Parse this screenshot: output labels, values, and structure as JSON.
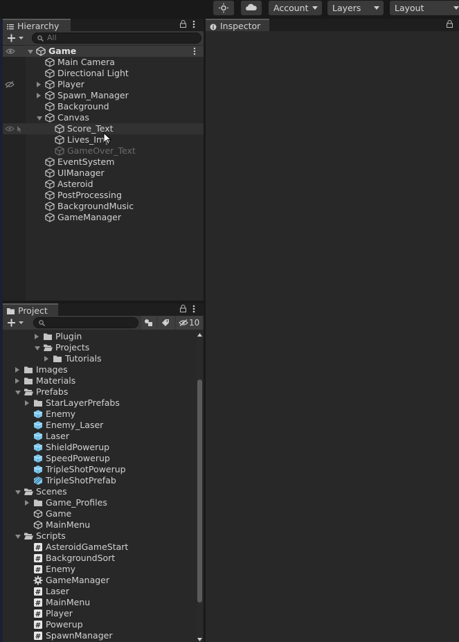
{
  "toolbar": {
    "account_label": "Account",
    "layers_label": "Layers",
    "layout_label": "Layout"
  },
  "hierarchy": {
    "tab_label": "Hierarchy",
    "search_placeholder": "All",
    "scene_name": "Game",
    "items": [
      {
        "label": "Main Camera",
        "depth": 1,
        "fold": "none"
      },
      {
        "label": "Directional Light",
        "depth": 1,
        "fold": "none"
      },
      {
        "label": "Player",
        "depth": 1,
        "fold": "closed"
      },
      {
        "label": "Spawn_Manager",
        "depth": 1,
        "fold": "closed"
      },
      {
        "label": "Background",
        "depth": 1,
        "fold": "none"
      },
      {
        "label": "Canvas",
        "depth": 1,
        "fold": "open"
      },
      {
        "label": "Score_Text",
        "depth": 2,
        "fold": "none"
      },
      {
        "label": "Lives_Img",
        "depth": 2,
        "fold": "none"
      },
      {
        "label": "GameOver_Text",
        "depth": 2,
        "fold": "none",
        "inactive": true
      },
      {
        "label": "EventSystem",
        "depth": 1,
        "fold": "none"
      },
      {
        "label": "UIManager",
        "depth": 1,
        "fold": "none"
      },
      {
        "label": "Asteroid",
        "depth": 1,
        "fold": "none"
      },
      {
        "label": "PostProcessing",
        "depth": 1,
        "fold": "none"
      },
      {
        "label": "BackgroundMusic",
        "depth": 1,
        "fold": "none"
      },
      {
        "label": "GameManager",
        "depth": 1,
        "fold": "none"
      }
    ]
  },
  "inspector": {
    "tab_label": "Inspector"
  },
  "project": {
    "tab_label": "Project",
    "hidden_count": "10",
    "items": [
      {
        "label": "Plugin",
        "depth": 2,
        "fold": "closed",
        "icon": "folder-icon"
      },
      {
        "label": "Projects",
        "depth": 2,
        "fold": "open",
        "icon": "folder-open-icon"
      },
      {
        "label": "Tutorials",
        "depth": 3,
        "fold": "closed",
        "icon": "folder-icon"
      },
      {
        "label": "Images",
        "depth": 0,
        "fold": "closed",
        "icon": "folder-icon"
      },
      {
        "label": "Materials",
        "depth": 0,
        "fold": "closed",
        "icon": "folder-icon"
      },
      {
        "label": "Prefabs",
        "depth": 0,
        "fold": "open",
        "icon": "folder-open-icon"
      },
      {
        "label": "StarLayerPrefabs",
        "depth": 1,
        "fold": "closed",
        "icon": "folder-icon"
      },
      {
        "label": "Enemy",
        "depth": 1,
        "fold": "none",
        "icon": "prefab-icon"
      },
      {
        "label": "Enemy_Laser",
        "depth": 1,
        "fold": "none",
        "icon": "prefab-icon"
      },
      {
        "label": "Laser",
        "depth": 1,
        "fold": "none",
        "icon": "prefab-icon"
      },
      {
        "label": "ShieldPowerup",
        "depth": 1,
        "fold": "none",
        "icon": "prefab-icon"
      },
      {
        "label": "SpeedPowerup",
        "depth": 1,
        "fold": "none",
        "icon": "prefab-icon"
      },
      {
        "label": "TripleShotPowerup",
        "depth": 1,
        "fold": "none",
        "icon": "prefab-icon"
      },
      {
        "label": "TripleShotPrefab",
        "depth": 1,
        "fold": "none",
        "icon": "prefab-variant-icon"
      },
      {
        "label": "Scenes",
        "depth": 0,
        "fold": "open",
        "icon": "folder-open-icon"
      },
      {
        "label": "Game_Profiles",
        "depth": 1,
        "fold": "closed",
        "icon": "folder-icon"
      },
      {
        "label": "Game",
        "depth": 1,
        "fold": "none",
        "icon": "scene-icon"
      },
      {
        "label": "MainMenu",
        "depth": 1,
        "fold": "none",
        "icon": "scene-icon"
      },
      {
        "label": "Scripts",
        "depth": 0,
        "fold": "open",
        "icon": "folder-open-icon"
      },
      {
        "label": "AsteroidGameStart",
        "depth": 1,
        "fold": "none",
        "icon": "script-icon"
      },
      {
        "label": "BackgroundSort",
        "depth": 1,
        "fold": "none",
        "icon": "script-icon"
      },
      {
        "label": "Enemy",
        "depth": 1,
        "fold": "none",
        "icon": "script-icon"
      },
      {
        "label": "GameManager",
        "depth": 1,
        "fold": "none",
        "icon": "gear-icon"
      },
      {
        "label": "Laser",
        "depth": 1,
        "fold": "none",
        "icon": "script-icon"
      },
      {
        "label": "MainMenu",
        "depth": 1,
        "fold": "none",
        "icon": "script-icon"
      },
      {
        "label": "Player",
        "depth": 1,
        "fold": "none",
        "icon": "script-icon"
      },
      {
        "label": "Powerup",
        "depth": 1,
        "fold": "none",
        "icon": "script-icon"
      },
      {
        "label": "SpawnManager",
        "depth": 1,
        "fold": "none",
        "icon": "script-icon"
      }
    ]
  }
}
